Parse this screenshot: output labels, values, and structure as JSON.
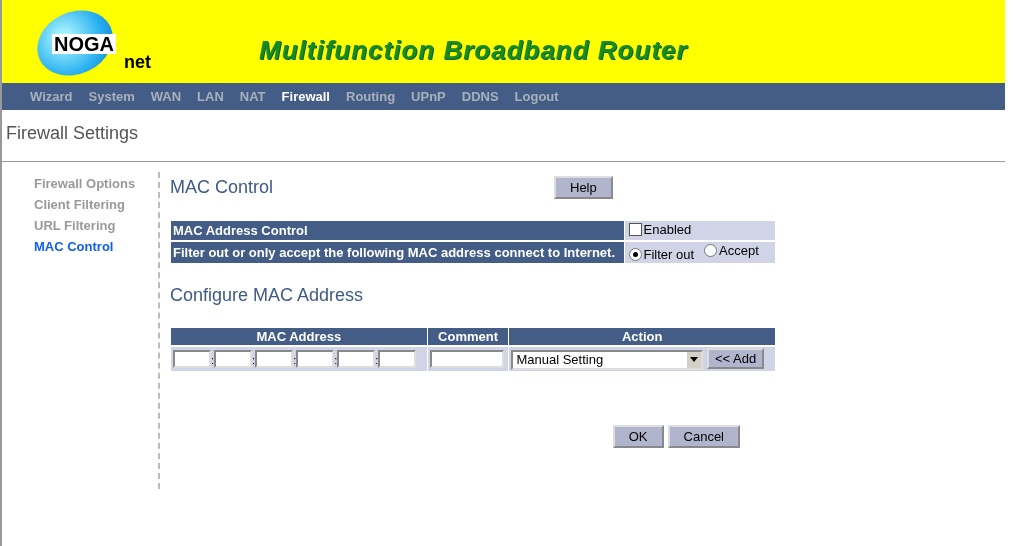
{
  "header": {
    "logo_top": "NOGA",
    "logo_bottom": "net",
    "title": "Multifunction Broadband Router"
  },
  "nav": [
    {
      "label": "Wizard",
      "selected": false
    },
    {
      "label": "System",
      "selected": false
    },
    {
      "label": "WAN",
      "selected": false
    },
    {
      "label": "LAN",
      "selected": false
    },
    {
      "label": "NAT",
      "selected": false
    },
    {
      "label": "Firewall",
      "selected": true
    },
    {
      "label": "Routing",
      "selected": false
    },
    {
      "label": "UPnP",
      "selected": false
    },
    {
      "label": "DDNS",
      "selected": false
    },
    {
      "label": "Logout",
      "selected": false
    }
  ],
  "page_title": "Firewall Settings",
  "sidebar": [
    {
      "label": "Firewall Options",
      "selected": false
    },
    {
      "label": "Client Filtering",
      "selected": false
    },
    {
      "label": "URL Filtering",
      "selected": false
    },
    {
      "label": "MAC Control",
      "selected": true
    }
  ],
  "section_title": "MAC Control",
  "help_button": "Help",
  "control_table": {
    "rows": [
      {
        "kind": "checkbox",
        "label": "MAC Address Control",
        "options": [
          {
            "label": "Enabled",
            "checked": false
          }
        ]
      },
      {
        "kind": "radio",
        "label": "Filter out or only accept  the following MAC address  connect to Internet.",
        "options": [
          {
            "label": "Filter out",
            "selected": true
          },
          {
            "label": "Accept",
            "selected": false
          }
        ]
      }
    ]
  },
  "configure_title": "Configure MAC Address",
  "mac_table": {
    "columns": [
      "MAC Address",
      "Comment",
      "Action"
    ],
    "mac_separators": [
      ":",
      ":",
      ":",
      ":",
      ":"
    ],
    "action_select": "Manual Setting",
    "add_button": "<< Add"
  },
  "buttons": [
    "OK",
    "Cancel"
  ]
}
